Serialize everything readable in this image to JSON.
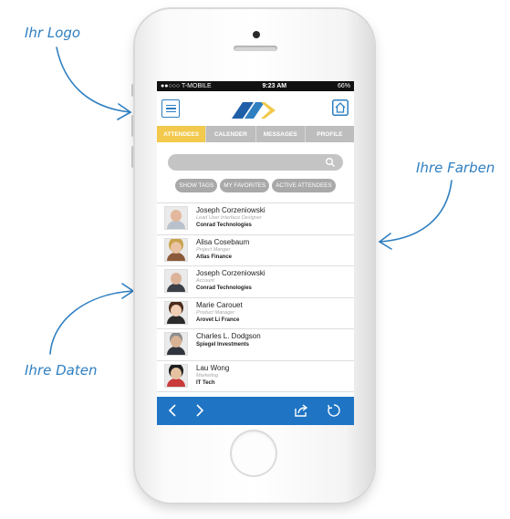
{
  "annotations": {
    "logo_label": "Ihr Logo",
    "colors_label": "Ihre Farben",
    "data_label": "Ihre Daten"
  },
  "status_bar": {
    "carrier": "●●○○○ T-MOBILE",
    "time": "9:23 AM",
    "battery": "66%"
  },
  "tabs": [
    "ATTENDEES",
    "CALENDER",
    "MESSAGES",
    "PROFILE"
  ],
  "search": {
    "placeholder": ""
  },
  "filters": [
    "SHOW TAGS",
    "MY FAVORITES",
    "ACTIVE ATTENDEES"
  ],
  "attendees": [
    {
      "name": "Joseph Corzeniowski",
      "role": "Lead User Interface Designer",
      "company": "Conrad Technologies"
    },
    {
      "name": "Alisa Cosebaum",
      "role": "Project Manger",
      "company": "Atlas Finance"
    },
    {
      "name": "Joseph Corzeniowski",
      "role": "Account",
      "company": "Conrad Technologies"
    },
    {
      "name": "Marie Carouet",
      "role": "Product Manager",
      "company": "Arovet Li France"
    },
    {
      "name": "Charles L. Dodgson",
      "role": "",
      "company": "Spiegel Investments"
    },
    {
      "name": "Lau Wong",
      "role": "Marketing",
      "company": "IT Tech"
    }
  ],
  "colors": {
    "accent_blue": "#1f74c4",
    "tab_active": "#f2c94c",
    "annotation": "#2f7fc1"
  }
}
